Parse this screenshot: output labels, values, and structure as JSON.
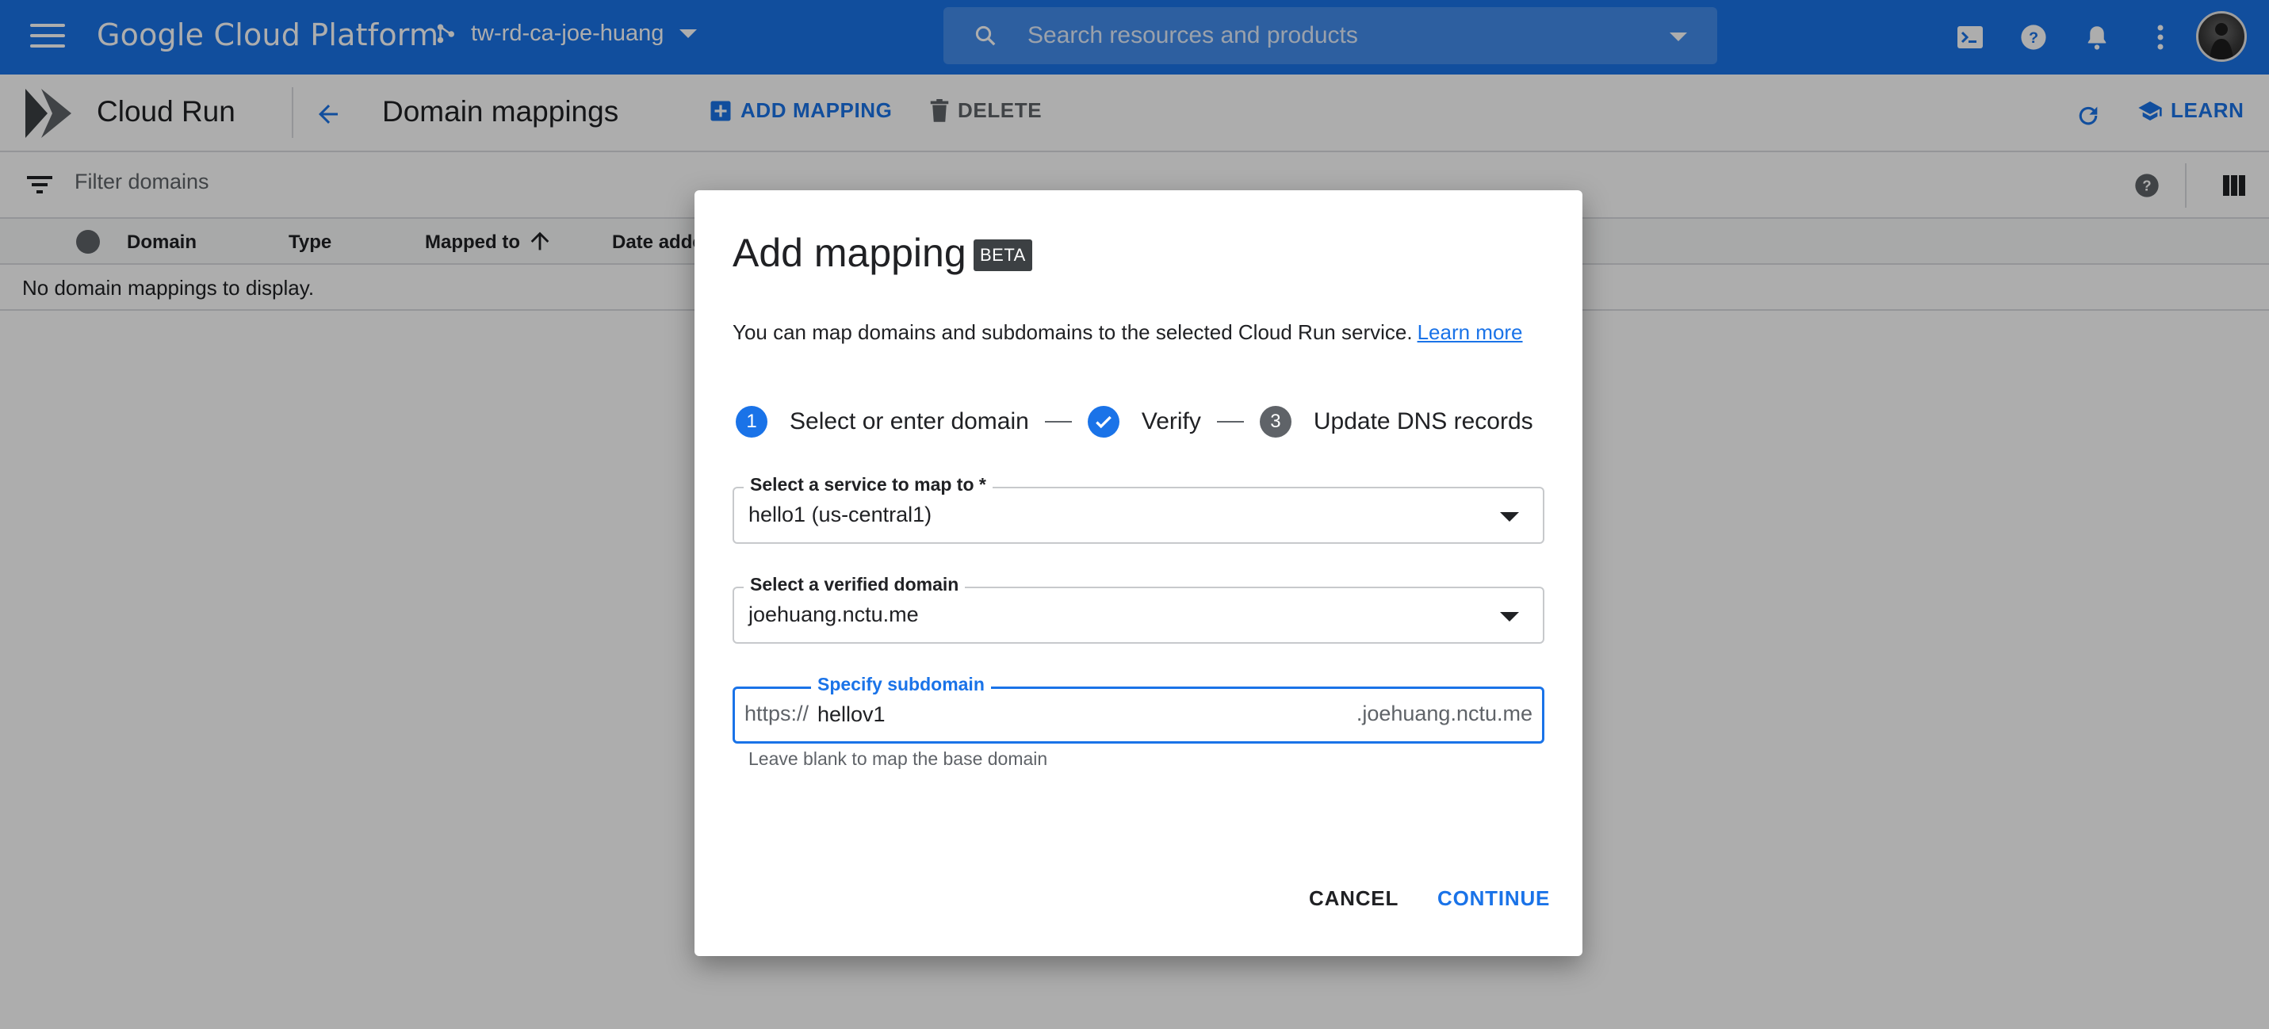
{
  "topbar": {
    "brand": "Google Cloud Platform",
    "project": "tw-rd-ca-joe-huang",
    "search_placeholder": "Search resources and products",
    "icons": [
      "cloud-shell-icon",
      "help-icon",
      "notifications-icon",
      "more-vert-icon"
    ],
    "accent_color": "#1a73e8"
  },
  "subheader": {
    "product": "Cloud Run",
    "page_title": "Domain mappings",
    "add_mapping": "ADD MAPPING",
    "delete": "DELETE",
    "learn": "LEARN"
  },
  "filter": {
    "placeholder": "Filter domains"
  },
  "table": {
    "columns": [
      "Domain",
      "Type",
      "Mapped to",
      "Date added"
    ],
    "sorted_by": "Mapped to",
    "sort_direction": "ascending",
    "empty_message": "No domain mappings to display."
  },
  "dialog": {
    "title": "Add mapping",
    "badge": "BETA",
    "description": "You can map domains and subdomains to the selected Cloud Run service.",
    "learn_more": "Learn more",
    "steps": [
      {
        "number": "1",
        "label": "Select or enter domain",
        "state": "active"
      },
      {
        "number": "2",
        "label": "Verify",
        "state": "completed"
      },
      {
        "number": "3",
        "label": "Update DNS records",
        "state": "pending"
      }
    ],
    "service_field": {
      "label": "Select a service to map to *",
      "value": "hello1 (us-central1)"
    },
    "domain_field": {
      "label": "Select a verified domain",
      "value": "joehuang.nctu.me"
    },
    "subdomain_field": {
      "label": "Specify subdomain",
      "prefix": "https://",
      "value": "hellov1",
      "suffix": ".joehuang.nctu.me",
      "hint": "Leave blank to map the base domain"
    },
    "cancel": "CANCEL",
    "continue": "CONTINUE"
  }
}
